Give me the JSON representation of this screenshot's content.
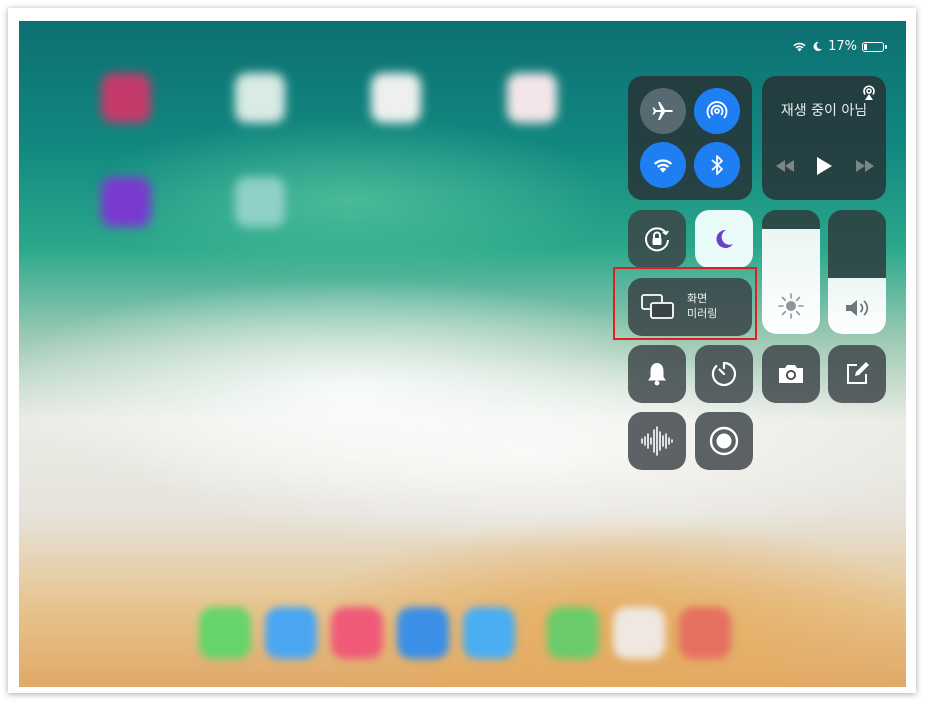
{
  "status_bar": {
    "battery_percent": "17%",
    "battery_level": 0.17
  },
  "control_center": {
    "connectivity": {
      "buttons": [
        {
          "name": "airplane-mode",
          "color": "#5a6a70"
        },
        {
          "name": "airdrop",
          "color": "#1e7ff2"
        },
        {
          "name": "wifi",
          "color": "#1e7ff2"
        },
        {
          "name": "bluetooth",
          "color": "#1e7ff2"
        }
      ]
    },
    "now_playing": {
      "status_label": "재생 중이 아님"
    },
    "screen_mirroring": {
      "line1": "화면",
      "line2": "미러링"
    },
    "brightness_level": 0.85,
    "volume_level": 0.45,
    "do_not_disturb_color": "#e8fbf9",
    "accent": "#1e7ff2",
    "highlight_color": "#e02020"
  }
}
